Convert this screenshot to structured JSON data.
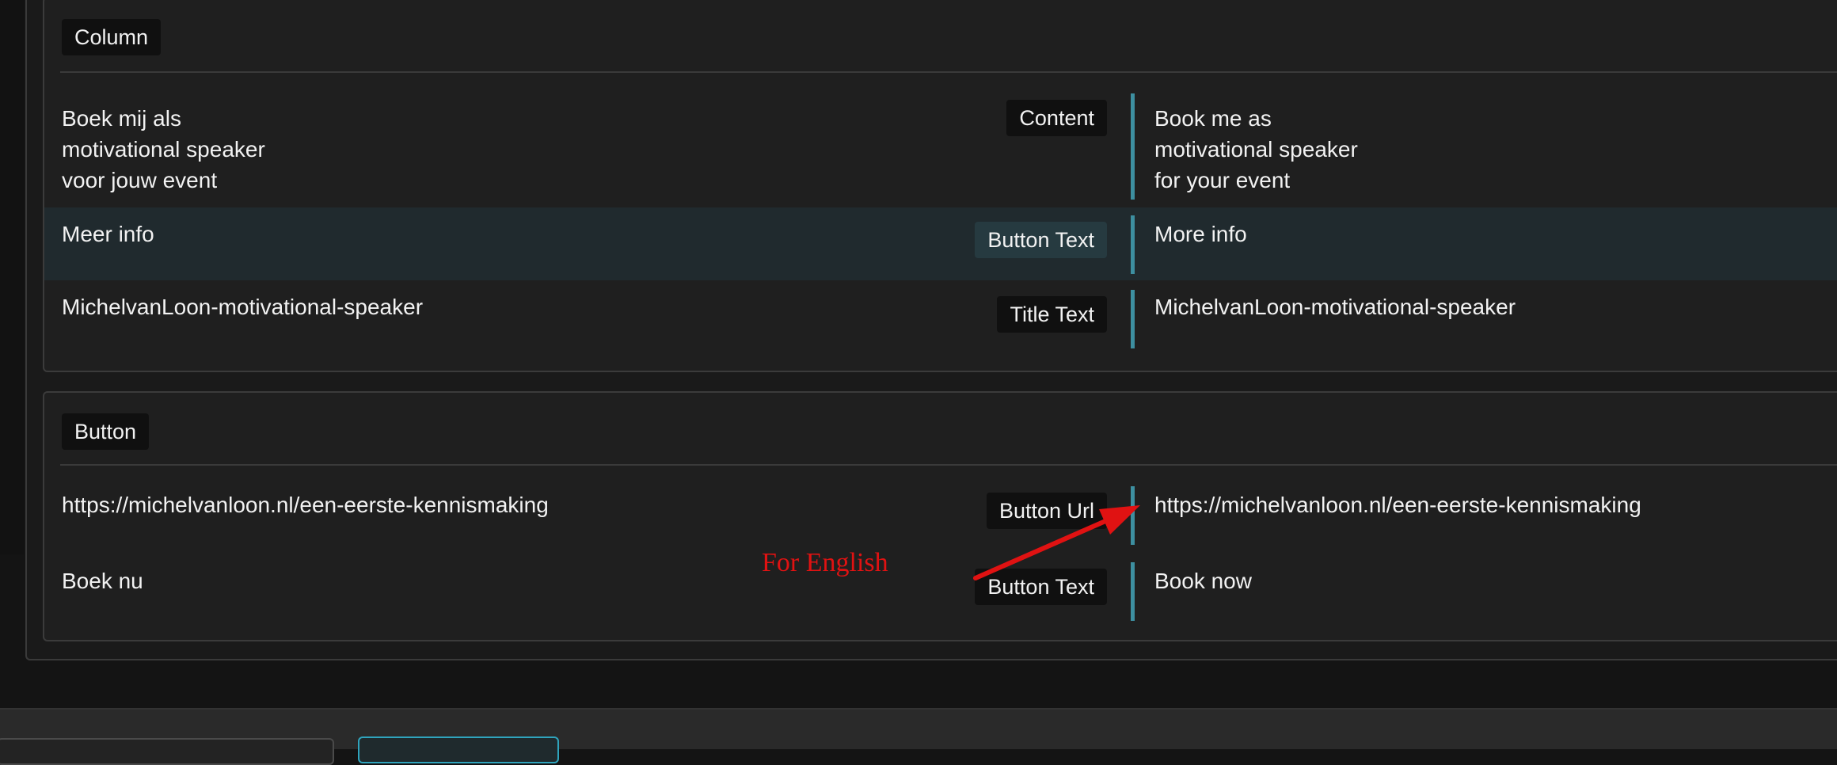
{
  "groups": {
    "column": {
      "label": "Column",
      "rows": [
        {
          "source": "Boek mij als\nmotivational speaker\nvoor jouw event",
          "field": "Content",
          "target": "Book me as\nmotivational speaker\nfor your event"
        },
        {
          "source": "Meer info",
          "field": "Button Text",
          "target": "More info"
        },
        {
          "source": "MichelvanLoon-motivational-speaker",
          "field": "Title Text",
          "target": "MichelvanLoon-motivational-speaker"
        }
      ]
    },
    "button": {
      "label": "Button",
      "rows": [
        {
          "source": "https://michelvanloon.nl/een-eerste-kennismaking",
          "field": "Button Url",
          "target": "https://michelvanloon.nl/een-eerste-kennismaking"
        },
        {
          "source": "Boek nu",
          "field": "Button Text",
          "target": "Book now"
        }
      ]
    }
  },
  "annotation": {
    "text": "For English",
    "color": "#e01212"
  },
  "colors": {
    "divider": "#3d8fa0",
    "highlight_row": "#202a2e",
    "accent_button": "#2fa4bd"
  }
}
